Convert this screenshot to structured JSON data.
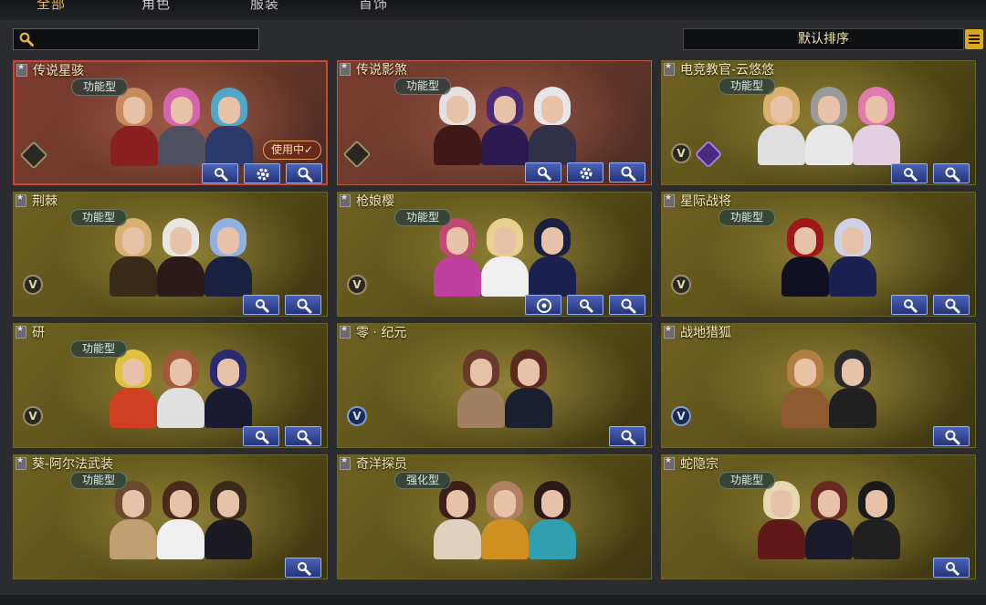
{
  "tabs": [
    {
      "label": "全部",
      "active": true
    },
    {
      "label": "角色",
      "active": false
    },
    {
      "label": "服装",
      "active": false
    },
    {
      "label": "首饰",
      "active": false
    }
  ],
  "search": {
    "icon": "search-icon",
    "value": ""
  },
  "sort": {
    "label": "默认排序",
    "menu_icon": "menu-icon"
  },
  "colors": {
    "accent": "#f3b63a",
    "selected_border": "#c24a3a",
    "button": "#3a4f9e"
  },
  "cards": [
    {
      "title": "传说星骇",
      "badge": "功能型",
      "emblem": "diamond",
      "status": "使用中✓",
      "selected": true,
      "buttons": [
        "settings-wrench",
        "gear",
        "search"
      ]
    },
    {
      "title": "传说影煞",
      "badge": "功能型",
      "emblem": "diamond",
      "selected": false,
      "buttons": [
        "settings-wrench",
        "gear",
        "search"
      ]
    },
    {
      "title": "电竞教官-云悠悠",
      "badge": "功能型",
      "emblem": "v",
      "emblem2": "purple-shield",
      "selected": false,
      "buttons": [
        "settings-wrench",
        "search"
      ]
    },
    {
      "title": "荆棘",
      "badge": "功能型",
      "emblem": "v",
      "selected": false,
      "buttons": [
        "settings-wrench",
        "search"
      ]
    },
    {
      "title": "枪娘樱",
      "badge": "功能型",
      "emblem": "v",
      "selected": false,
      "buttons": [
        "disc",
        "settings-wrench",
        "search"
      ]
    },
    {
      "title": "星际战将",
      "badge": "功能型",
      "emblem": "v",
      "selected": false,
      "buttons": [
        "settings-wrench",
        "search"
      ]
    },
    {
      "title": "研",
      "badge": "功能型",
      "emblem": "v",
      "selected": false,
      "buttons": [
        "settings-wrench",
        "search"
      ]
    },
    {
      "title": "零 · 纪元",
      "badge": "",
      "emblem": "v-blue",
      "selected": false,
      "buttons": [
        "search"
      ]
    },
    {
      "title": "战地猎狐",
      "badge": "",
      "emblem": "v-blue",
      "selected": false,
      "buttons": [
        "search"
      ]
    },
    {
      "title": "葵-阿尔法武装",
      "badge": "功能型",
      "emblem": "",
      "selected": false,
      "buttons": [
        "settings-wrench"
      ]
    },
    {
      "title": "奇洋探员",
      "badge": "强化型",
      "emblem": "",
      "selected": false,
      "buttons": []
    },
    {
      "title": "蛇隐宗",
      "badge": "功能型",
      "emblem": "",
      "selected": false,
      "buttons": [
        "settings-wrench"
      ]
    }
  ]
}
